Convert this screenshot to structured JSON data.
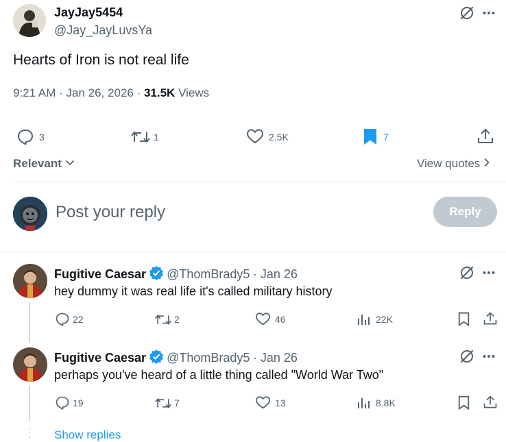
{
  "tweet": {
    "author_name": "JayJay5454",
    "author_handle": "@Jay_JayLuvsYa",
    "text": "Hearts of Iron is not real life",
    "time": "9:21 AM",
    "sep1": "·",
    "date": "Jan 26, 2026",
    "sep2": "·",
    "views_count": "31.5K",
    "views_label": "Views",
    "replies": "3",
    "reposts": "1",
    "likes": "2.5K",
    "bookmarks": "7"
  },
  "sort": {
    "label": "Relevant"
  },
  "quotes": {
    "label": "View quotes"
  },
  "composer": {
    "placeholder": "Post your reply",
    "button": "Reply"
  },
  "replies": [
    {
      "name": "Fugitive Caesar",
      "handle": "@ThomBrady5",
      "date": "· Jan 26",
      "text": "hey dummy it was real life it's called military history",
      "replies": "22",
      "reposts": "2",
      "likes": "46",
      "views": "22K"
    },
    {
      "name": "Fugitive Caesar",
      "handle": "@ThomBrady5",
      "date": "· Jan 26",
      "text": "perhaps you've heard of a little thing called \"World War Two\"",
      "replies": "19",
      "reposts": "7",
      "likes": "13",
      "views": "8.8K"
    }
  ],
  "thread": {
    "show_replies": "Show replies"
  },
  "colors": {
    "accent": "#1d9bf0",
    "muted": "#536471",
    "bookmark_active": "#1d9bf0",
    "reply_button_disabled": "#cfd9de"
  },
  "icons": [
    "grok-icon",
    "more-icon",
    "reply-icon",
    "repost-icon",
    "like-icon",
    "bookmark-icon",
    "share-icon",
    "views-icon",
    "verified-icon",
    "chevron-down-icon",
    "chevron-right-icon"
  ]
}
